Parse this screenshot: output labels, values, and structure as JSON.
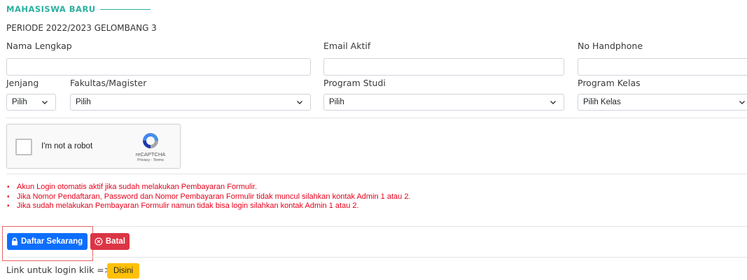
{
  "section": {
    "heading": "MAHASISWA BARU",
    "period": "PERIODE 2022/2023 GELOMBANG 3"
  },
  "fields": {
    "name_label": "Nama Lengkap",
    "email_label": "Email Aktif",
    "phone_label": "No Handphone",
    "name_value": "",
    "email_value": "",
    "phone_value": ""
  },
  "selects": {
    "jenjang_label": "Jenjang",
    "jenjang_value": "Pilih",
    "fakultas_label": "Fakultas/Magister",
    "fakultas_value": "Pilih",
    "prodi_label": "Program Studi",
    "prodi_value": "Pilih",
    "kelas_label": "Program Kelas",
    "kelas_value": "Pilih Kelas"
  },
  "captcha": {
    "checkbox_label": "I'm not a robot",
    "brand": "reCAPTCHA",
    "links": "Privacy - Terms"
  },
  "notes": [
    "Akun Login otomatis aktif jika sudah melakukan Pembayaran Formulir.",
    "Jika Nomor Pendaftaran, Password dan Nomor Pembayaran Formulir tidak muncul silahkan kontak Admin 1 atau 2.",
    "Jika sudah melakukan Pembayaran Formulir namun tidak bisa login silahkan kontak Admin 1 atau 2."
  ],
  "actions": {
    "register_label": "Daftar Sekarang",
    "cancel_label": "Batal"
  },
  "login": {
    "text": "Link untuk login klik =>",
    "button_label": "Disini"
  },
  "colors": {
    "heading": "#2bb0a1",
    "primary": "#0d6efd",
    "danger": "#dc3545",
    "warning": "#ffc107",
    "notes": "#e6001a"
  },
  "icons": {
    "lock": "lock-icon",
    "cancel": "circle-x-icon",
    "chevron": "chevron-down-icon",
    "recaptcha": "recaptcha-logo-icon"
  }
}
